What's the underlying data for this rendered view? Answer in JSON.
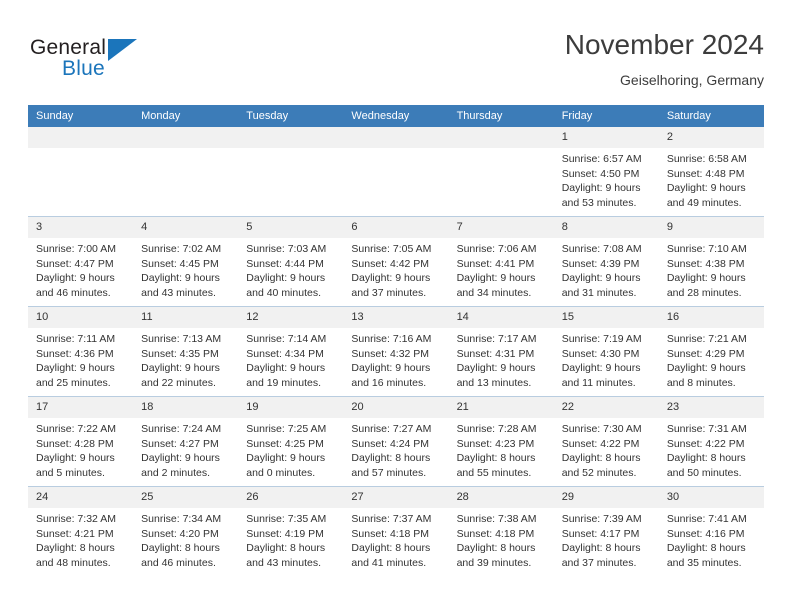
{
  "brand": {
    "name_top": "General",
    "name_bottom": "Blue",
    "flag_icon": "triangle-flag-icon",
    "colors": {
      "blue": "#1b75bb",
      "dark": "#231f20"
    }
  },
  "header": {
    "title": "November 2024",
    "subtitle": "Geiselhoring, Germany"
  },
  "theme": {
    "header_bg": "#3c7cb8",
    "daynum_bg": "#f1f1f1",
    "grid_line": "#b9cde0",
    "text": "#333333"
  },
  "calendar": {
    "weekday_headers": [
      "Sunday",
      "Monday",
      "Tuesday",
      "Wednesday",
      "Thursday",
      "Friday",
      "Saturday"
    ],
    "weeks": [
      [
        {
          "day": "",
          "empty": true
        },
        {
          "day": "",
          "empty": true
        },
        {
          "day": "",
          "empty": true
        },
        {
          "day": "",
          "empty": true
        },
        {
          "day": "",
          "empty": true
        },
        {
          "day": "1",
          "sunrise": "Sunrise: 6:57 AM",
          "sunset": "Sunset: 4:50 PM",
          "daylight": "Daylight: 9 hours and 53 minutes."
        },
        {
          "day": "2",
          "sunrise": "Sunrise: 6:58 AM",
          "sunset": "Sunset: 4:48 PM",
          "daylight": "Daylight: 9 hours and 49 minutes."
        }
      ],
      [
        {
          "day": "3",
          "sunrise": "Sunrise: 7:00 AM",
          "sunset": "Sunset: 4:47 PM",
          "daylight": "Daylight: 9 hours and 46 minutes."
        },
        {
          "day": "4",
          "sunrise": "Sunrise: 7:02 AM",
          "sunset": "Sunset: 4:45 PM",
          "daylight": "Daylight: 9 hours and 43 minutes."
        },
        {
          "day": "5",
          "sunrise": "Sunrise: 7:03 AM",
          "sunset": "Sunset: 4:44 PM",
          "daylight": "Daylight: 9 hours and 40 minutes."
        },
        {
          "day": "6",
          "sunrise": "Sunrise: 7:05 AM",
          "sunset": "Sunset: 4:42 PM",
          "daylight": "Daylight: 9 hours and 37 minutes."
        },
        {
          "day": "7",
          "sunrise": "Sunrise: 7:06 AM",
          "sunset": "Sunset: 4:41 PM",
          "daylight": "Daylight: 9 hours and 34 minutes."
        },
        {
          "day": "8",
          "sunrise": "Sunrise: 7:08 AM",
          "sunset": "Sunset: 4:39 PM",
          "daylight": "Daylight: 9 hours and 31 minutes."
        },
        {
          "day": "9",
          "sunrise": "Sunrise: 7:10 AM",
          "sunset": "Sunset: 4:38 PM",
          "daylight": "Daylight: 9 hours and 28 minutes."
        }
      ],
      [
        {
          "day": "10",
          "sunrise": "Sunrise: 7:11 AM",
          "sunset": "Sunset: 4:36 PM",
          "daylight": "Daylight: 9 hours and 25 minutes."
        },
        {
          "day": "11",
          "sunrise": "Sunrise: 7:13 AM",
          "sunset": "Sunset: 4:35 PM",
          "daylight": "Daylight: 9 hours and 22 minutes."
        },
        {
          "day": "12",
          "sunrise": "Sunrise: 7:14 AM",
          "sunset": "Sunset: 4:34 PM",
          "daylight": "Daylight: 9 hours and 19 minutes."
        },
        {
          "day": "13",
          "sunrise": "Sunrise: 7:16 AM",
          "sunset": "Sunset: 4:32 PM",
          "daylight": "Daylight: 9 hours and 16 minutes."
        },
        {
          "day": "14",
          "sunrise": "Sunrise: 7:17 AM",
          "sunset": "Sunset: 4:31 PM",
          "daylight": "Daylight: 9 hours and 13 minutes."
        },
        {
          "day": "15",
          "sunrise": "Sunrise: 7:19 AM",
          "sunset": "Sunset: 4:30 PM",
          "daylight": "Daylight: 9 hours and 11 minutes."
        },
        {
          "day": "16",
          "sunrise": "Sunrise: 7:21 AM",
          "sunset": "Sunset: 4:29 PM",
          "daylight": "Daylight: 9 hours and 8 minutes."
        }
      ],
      [
        {
          "day": "17",
          "sunrise": "Sunrise: 7:22 AM",
          "sunset": "Sunset: 4:28 PM",
          "daylight": "Daylight: 9 hours and 5 minutes."
        },
        {
          "day": "18",
          "sunrise": "Sunrise: 7:24 AM",
          "sunset": "Sunset: 4:27 PM",
          "daylight": "Daylight: 9 hours and 2 minutes."
        },
        {
          "day": "19",
          "sunrise": "Sunrise: 7:25 AM",
          "sunset": "Sunset: 4:25 PM",
          "daylight": "Daylight: 9 hours and 0 minutes."
        },
        {
          "day": "20",
          "sunrise": "Sunrise: 7:27 AM",
          "sunset": "Sunset: 4:24 PM",
          "daylight": "Daylight: 8 hours and 57 minutes."
        },
        {
          "day": "21",
          "sunrise": "Sunrise: 7:28 AM",
          "sunset": "Sunset: 4:23 PM",
          "daylight": "Daylight: 8 hours and 55 minutes."
        },
        {
          "day": "22",
          "sunrise": "Sunrise: 7:30 AM",
          "sunset": "Sunset: 4:22 PM",
          "daylight": "Daylight: 8 hours and 52 minutes."
        },
        {
          "day": "23",
          "sunrise": "Sunrise: 7:31 AM",
          "sunset": "Sunset: 4:22 PM",
          "daylight": "Daylight: 8 hours and 50 minutes."
        }
      ],
      [
        {
          "day": "24",
          "sunrise": "Sunrise: 7:32 AM",
          "sunset": "Sunset: 4:21 PM",
          "daylight": "Daylight: 8 hours and 48 minutes."
        },
        {
          "day": "25",
          "sunrise": "Sunrise: 7:34 AM",
          "sunset": "Sunset: 4:20 PM",
          "daylight": "Daylight: 8 hours and 46 minutes."
        },
        {
          "day": "26",
          "sunrise": "Sunrise: 7:35 AM",
          "sunset": "Sunset: 4:19 PM",
          "daylight": "Daylight: 8 hours and 43 minutes."
        },
        {
          "day": "27",
          "sunrise": "Sunrise: 7:37 AM",
          "sunset": "Sunset: 4:18 PM",
          "daylight": "Daylight: 8 hours and 41 minutes."
        },
        {
          "day": "28",
          "sunrise": "Sunrise: 7:38 AM",
          "sunset": "Sunset: 4:18 PM",
          "daylight": "Daylight: 8 hours and 39 minutes."
        },
        {
          "day": "29",
          "sunrise": "Sunrise: 7:39 AM",
          "sunset": "Sunset: 4:17 PM",
          "daylight": "Daylight: 8 hours and 37 minutes."
        },
        {
          "day": "30",
          "sunrise": "Sunrise: 7:41 AM",
          "sunset": "Sunset: 4:16 PM",
          "daylight": "Daylight: 8 hours and 35 minutes."
        }
      ]
    ]
  }
}
